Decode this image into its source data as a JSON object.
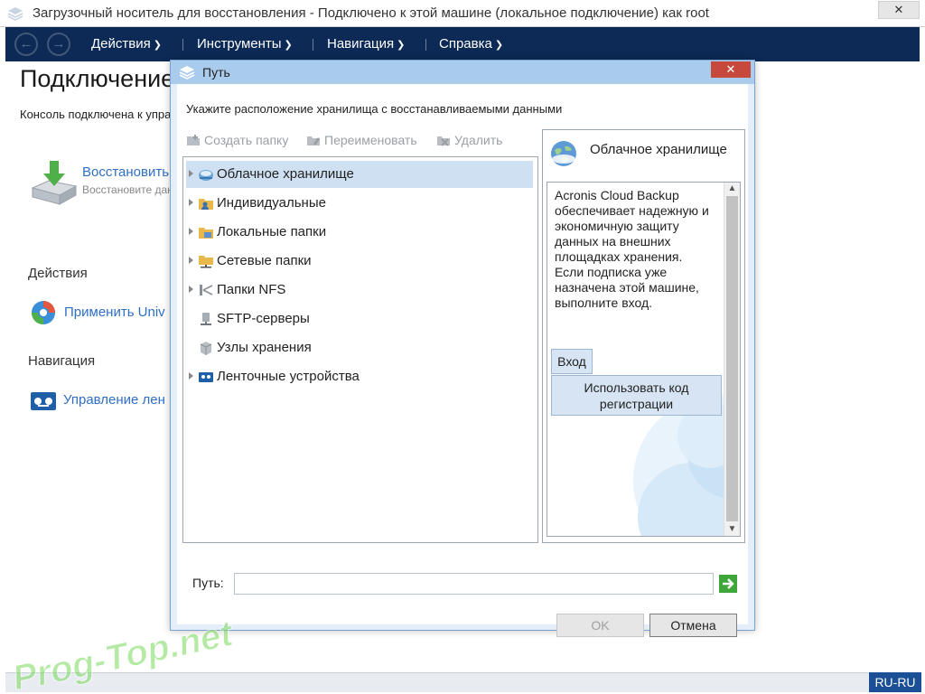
{
  "window": {
    "title": "Загрузочный носитель для восстановления - Подключено к этой машине (локальное подключение) как root",
    "close_glyph": "✕"
  },
  "menubar": {
    "back_glyph": "←",
    "forward_glyph": "→",
    "items": [
      {
        "label": "Действия"
      },
      {
        "label": "Инструменты"
      },
      {
        "label": "Навигация"
      },
      {
        "label": "Справка"
      }
    ]
  },
  "background_page": {
    "title": "Подключение",
    "subtitle": "Консоль подключена к управ",
    "restore_link": "Восстановить",
    "restore_desc": "Восстановите данн",
    "actions_heading": "Действия",
    "apply_link": "Применить Univ",
    "navigation_heading": "Навигация",
    "manage_link": "Управление лен"
  },
  "dialog": {
    "title": "Путь",
    "close_glyph": "✕",
    "prompt": "Укажите расположение хранилища с восстанавливаемыми данными",
    "toolbar": {
      "create_folder": "Создать папку",
      "rename": "Переименовать",
      "delete": "Удалить"
    },
    "tree": [
      {
        "label": "Облачное хранилище",
        "icon": "cloud-storage-icon",
        "arrow": true,
        "selected": true
      },
      {
        "label": "Индивидуальные",
        "icon": "personal-folder-icon",
        "arrow": true,
        "selected": false
      },
      {
        "label": "Локальные папки",
        "icon": "local-folder-icon",
        "arrow": true,
        "selected": false
      },
      {
        "label": "Сетевые папки",
        "icon": "network-folder-icon",
        "arrow": true,
        "selected": false
      },
      {
        "label": "Папки NFS",
        "icon": "nfs-icon",
        "arrow": true,
        "selected": false
      },
      {
        "label": "SFTP-серверы",
        "icon": "sftp-server-icon",
        "arrow": false,
        "selected": false
      },
      {
        "label": "Узлы хранения",
        "icon": "storage-node-icon",
        "arrow": false,
        "selected": false
      },
      {
        "label": "Ленточные устройства",
        "icon": "tape-device-icon",
        "arrow": true,
        "selected": false
      }
    ],
    "info": {
      "title": "Облачное хранилище",
      "text": "Acronis Cloud Backup обеспечивает надежную и экономичную защиту данных на внешних площадках хранения. Если подписка уже назначена этой машине, выполните вход.",
      "login_button": "Вход",
      "regcode_button": "Использовать код регистрации"
    },
    "path": {
      "label": "Путь:",
      "value": "",
      "placeholder": ""
    },
    "ok_button": "OK",
    "cancel_button": "Отмена"
  },
  "statusbar": {
    "locale": "RU-RU"
  },
  "watermark": "Prog-Top.net",
  "colors": {
    "menubar": "#0c2a55",
    "dialog_title": "#a9cbec",
    "close_red": "#c7483d",
    "link_blue": "#2f6fc5",
    "selection": "#cfe0f3"
  }
}
